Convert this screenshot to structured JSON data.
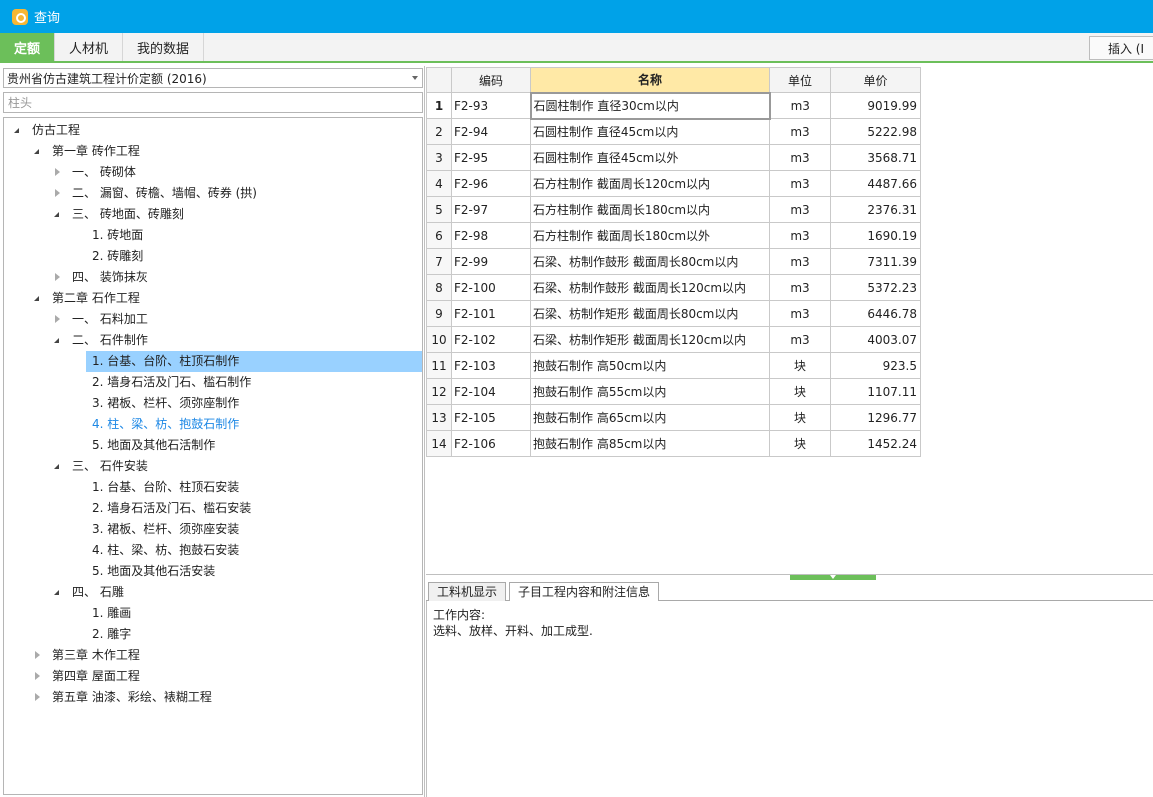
{
  "window": {
    "title": "查询"
  },
  "tabs": [
    {
      "label": "定额",
      "active": true
    },
    {
      "label": "人材机",
      "active": false
    },
    {
      "label": "我的数据",
      "active": false
    }
  ],
  "toolbar": {
    "insert_label": "插入 (I"
  },
  "left": {
    "quota_select": "贵州省仿古建筑工程计价定额 (2016)",
    "search_placeholder": "柱头"
  },
  "tree": [
    {
      "level": 0,
      "toggle": "expanded",
      "label": "仿古工程"
    },
    {
      "level": 1,
      "toggle": "expanded",
      "label": "第一章  砖作工程"
    },
    {
      "level": 2,
      "toggle": "collapsed",
      "label": "一、  砖砌体"
    },
    {
      "level": 2,
      "toggle": "collapsed",
      "label": "二、  漏窗、砖檐、墙帽、砖券 (拱)"
    },
    {
      "level": 2,
      "toggle": "expanded",
      "label": "三、  砖地面、砖雕刻"
    },
    {
      "level": 3,
      "toggle": "none",
      "label": "1.  砖地面"
    },
    {
      "level": 3,
      "toggle": "none",
      "label": "2.  砖雕刻"
    },
    {
      "level": 2,
      "toggle": "collapsed",
      "label": "四、  装饰抹灰"
    },
    {
      "level": 1,
      "toggle": "expanded",
      "label": "第二章  石作工程"
    },
    {
      "level": 2,
      "toggle": "collapsed",
      "label": "一、  石料加工"
    },
    {
      "level": 2,
      "toggle": "expanded",
      "label": "二、  石件制作"
    },
    {
      "level": 3,
      "toggle": "none",
      "label": "1.  台基、台阶、柱顶石制作",
      "selected": true
    },
    {
      "level": 3,
      "toggle": "none",
      "label": "2.  墙身石活及门石、槛石制作"
    },
    {
      "level": 3,
      "toggle": "none",
      "label": "3.  裙板、栏杆、须弥座制作"
    },
    {
      "level": 3,
      "toggle": "none",
      "label": "4.  柱、梁、枋、抱鼓石制作",
      "highlight": true
    },
    {
      "level": 3,
      "toggle": "none",
      "label": "5.  地面及其他石活制作"
    },
    {
      "level": 2,
      "toggle": "expanded",
      "label": "三、  石件安装"
    },
    {
      "level": 3,
      "toggle": "none",
      "label": "1.  台基、台阶、柱顶石安装"
    },
    {
      "level": 3,
      "toggle": "none",
      "label": "2.  墙身石活及门石、槛石安装"
    },
    {
      "level": 3,
      "toggle": "none",
      "label": "3.  裙板、栏杆、须弥座安装"
    },
    {
      "level": 3,
      "toggle": "none",
      "label": "4.  柱、梁、枋、抱鼓石安装"
    },
    {
      "level": 3,
      "toggle": "none",
      "label": "5.  地面及其他石活安装"
    },
    {
      "level": 2,
      "toggle": "expanded",
      "label": "四、  石雕"
    },
    {
      "level": 3,
      "toggle": "none",
      "label": "1.  雕画"
    },
    {
      "level": 3,
      "toggle": "none",
      "label": "2.  雕字"
    },
    {
      "level": 1,
      "toggle": "collapsed",
      "label": "第三章  木作工程"
    },
    {
      "level": 1,
      "toggle": "collapsed",
      "label": "第四章  屋面工程"
    },
    {
      "level": 1,
      "toggle": "collapsed",
      "label": "第五章  油漆、彩绘、裱糊工程"
    }
  ],
  "grid": {
    "columns": [
      "",
      "编码",
      "名称",
      "单位",
      "单价"
    ],
    "rows": [
      {
        "n": "1",
        "code": "F2-93",
        "name": "石圆柱制作 直径30cm以内",
        "unit": "m3",
        "price": "9019.99"
      },
      {
        "n": "2",
        "code": "F2-94",
        "name": "石圆柱制作 直径45cm以内",
        "unit": "m3",
        "price": "5222.98"
      },
      {
        "n": "3",
        "code": "F2-95",
        "name": "石圆柱制作 直径45cm以外",
        "unit": "m3",
        "price": "3568.71"
      },
      {
        "n": "4",
        "code": "F2-96",
        "name": "石方柱制作 截面周长120cm以内",
        "unit": "m3",
        "price": "4487.66"
      },
      {
        "n": "5",
        "code": "F2-97",
        "name": "石方柱制作 截面周长180cm以内",
        "unit": "m3",
        "price": "2376.31"
      },
      {
        "n": "6",
        "code": "F2-98",
        "name": "石方柱制作 截面周长180cm以外",
        "unit": "m3",
        "price": "1690.19"
      },
      {
        "n": "7",
        "code": "F2-99",
        "name": "石梁、枋制作鼓形 截面周长80cm以内",
        "unit": "m3",
        "price": "7311.39"
      },
      {
        "n": "8",
        "code": "F2-100",
        "name": "石梁、枋制作鼓形 截面周长120cm以内",
        "unit": "m3",
        "price": "5372.23"
      },
      {
        "n": "9",
        "code": "F2-101",
        "name": "石梁、枋制作矩形 截面周长80cm以内",
        "unit": "m3",
        "price": "6446.78"
      },
      {
        "n": "10",
        "code": "F2-102",
        "name": "石梁、枋制作矩形 截面周长120cm以内",
        "unit": "m3",
        "price": "4003.07"
      },
      {
        "n": "11",
        "code": "F2-103",
        "name": "抱鼓石制作 高50cm以内",
        "unit": "块",
        "price": "923.5"
      },
      {
        "n": "12",
        "code": "F2-104",
        "name": "抱鼓石制作 高55cm以内",
        "unit": "块",
        "price": "1107.11"
      },
      {
        "n": "13",
        "code": "F2-105",
        "name": "抱鼓石制作 高65cm以内",
        "unit": "块",
        "price": "1296.77"
      },
      {
        "n": "14",
        "code": "F2-106",
        "name": "抱鼓石制作 高85cm以内",
        "unit": "块",
        "price": "1452.24"
      }
    ]
  },
  "bottom": {
    "tabs": [
      "工料机显示",
      "子目工程内容和附注信息"
    ],
    "info_heading": "工作内容:",
    "info_text": "选料、放样、开料、加工成型."
  }
}
